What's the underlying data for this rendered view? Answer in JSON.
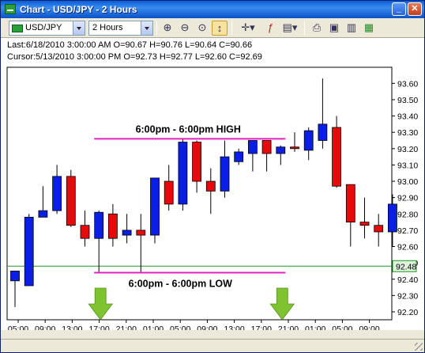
{
  "window": {
    "title": "Chart - USD/JPY - 2 Hours"
  },
  "toolbar": {
    "symbol": "USD/JPY",
    "period": "2 Hours",
    "tools": [
      "zoom-in-icon",
      "zoom-out-icon",
      "zoom-fit-icon",
      "cursor-icon",
      "crosshair-icon",
      "function-icon",
      "indicator-icon",
      "print-icon",
      "save-icon",
      "export-icon",
      "settings-icon"
    ]
  },
  "info": {
    "last": "Last:6/18/2010 3:00:00 AM O=90.67 H=90.76 L=90.64 C=90.66",
    "cursor": "Cursor:5/13/2010 3:00:00 PM O=92.73 H=92.77 L=92.60 C=92.69"
  },
  "chart_data": {
    "type": "candlestick",
    "ylim": [
      92.2,
      93.65
    ],
    "y_ticks": [
      "93.60",
      "93.50",
      "93.40",
      "93.30",
      "93.20",
      "93.10",
      "93.00",
      "92.90",
      "92.80",
      "92.70",
      "92.60",
      "92.50",
      "92.40",
      "92.30",
      "92.20"
    ],
    "current_price_label": "92.48",
    "current_price": 92.48,
    "x_tick_labels": [
      "05:00",
      "09:00",
      "13:00",
      "17:00",
      "21:00",
      "01:00",
      "05:00",
      "09:00",
      "13:00",
      "17:00",
      "21:00",
      "01:00",
      "05:00",
      "09:00"
    ],
    "candles": [
      {
        "o": 92.39,
        "h": 92.45,
        "l": 92.23,
        "c": 92.45
      },
      {
        "o": 92.36,
        "h": 92.8,
        "l": 92.36,
        "c": 92.78
      },
      {
        "o": 92.78,
        "h": 92.97,
        "l": 92.78,
        "c": 92.82
      },
      {
        "o": 92.82,
        "h": 93.1,
        "l": 92.8,
        "c": 93.03
      },
      {
        "o": 93.03,
        "h": 93.07,
        "l": 92.72,
        "c": 92.73
      },
      {
        "o": 92.73,
        "h": 92.82,
        "l": 92.6,
        "c": 92.65
      },
      {
        "o": 92.65,
        "h": 92.82,
        "l": 92.44,
        "c": 92.81
      },
      {
        "o": 92.8,
        "h": 92.86,
        "l": 92.6,
        "c": 92.65
      },
      {
        "o": 92.67,
        "h": 92.8,
        "l": 92.62,
        "c": 92.7
      },
      {
        "o": 92.7,
        "h": 92.8,
        "l": 92.44,
        "c": 92.67
      },
      {
        "o": 92.67,
        "h": 93.02,
        "l": 92.62,
        "c": 93.02
      },
      {
        "o": 93.0,
        "h": 93.1,
        "l": 92.82,
        "c": 92.86
      },
      {
        "o": 92.86,
        "h": 93.26,
        "l": 92.82,
        "c": 93.24
      },
      {
        "o": 93.24,
        "h": 93.25,
        "l": 92.93,
        "c": 93.0
      },
      {
        "o": 93.0,
        "h": 93.08,
        "l": 92.8,
        "c": 92.94
      },
      {
        "o": 92.94,
        "h": 93.25,
        "l": 92.9,
        "c": 93.15
      },
      {
        "o": 93.12,
        "h": 93.2,
        "l": 93.1,
        "c": 93.18
      },
      {
        "o": 93.17,
        "h": 93.25,
        "l": 93.06,
        "c": 93.25
      },
      {
        "o": 93.25,
        "h": 93.25,
        "l": 93.06,
        "c": 93.17
      },
      {
        "o": 93.17,
        "h": 93.22,
        "l": 93.1,
        "c": 93.21
      },
      {
        "o": 93.21,
        "h": 93.3,
        "l": 93.18,
        "c": 93.2
      },
      {
        "o": 93.19,
        "h": 93.33,
        "l": 93.13,
        "c": 93.31
      },
      {
        "o": 93.25,
        "h": 93.63,
        "l": 93.2,
        "c": 93.35
      },
      {
        "o": 93.33,
        "h": 93.4,
        "l": 92.96,
        "c": 92.97
      },
      {
        "o": 92.98,
        "h": 92.98,
        "l": 92.6,
        "c": 92.75
      },
      {
        "o": 92.75,
        "h": 92.9,
        "l": 92.65,
        "c": 92.73
      },
      {
        "o": 92.73,
        "h": 92.8,
        "l": 92.6,
        "c": 92.69
      },
      {
        "o": 92.69,
        "h": 92.92,
        "l": 92.6,
        "c": 92.86
      }
    ],
    "annotations": [
      {
        "text": "6:00pm - 6:00pm HIGH",
        "price": 93.26,
        "from_candle": 6,
        "to_candle": 19
      },
      {
        "text": "6:00pm - 6:00pm LOW",
        "price": 92.44,
        "from_candle": 6,
        "to_candle": 19
      }
    ],
    "arrows_at_candles": [
      6,
      19
    ],
    "colors": {
      "bull": "#0a1ee6",
      "bear": "#e60a0a",
      "annotation": "#e020c0",
      "price_line": "#1a9a1a",
      "arrow": "#7ac025"
    }
  }
}
